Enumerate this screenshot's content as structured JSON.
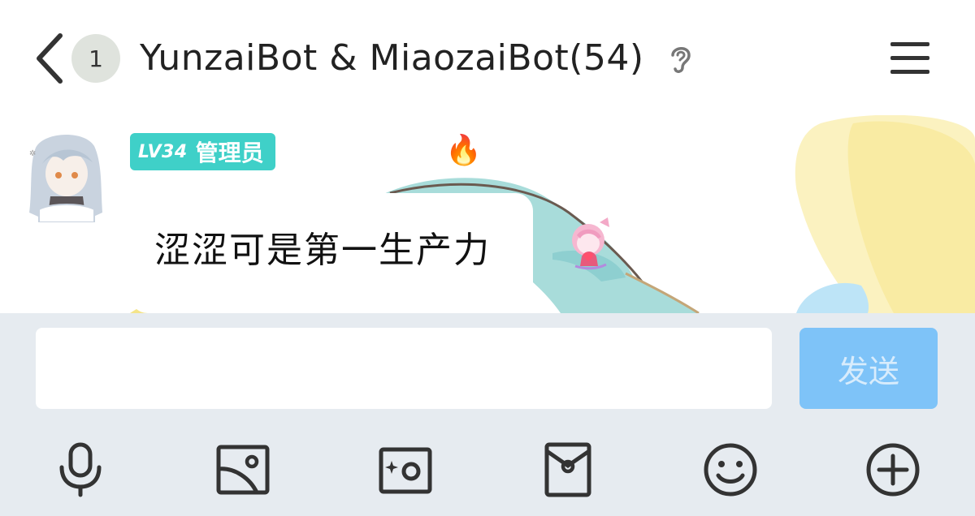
{
  "header": {
    "unread_count": "1",
    "title": "YunzaiBot & MiaozaiBot(54)"
  },
  "message": {
    "level": "LV34",
    "role": "管理员",
    "text": "涩涩可是第一生产力"
  },
  "composer": {
    "input_value": "",
    "send_label": "发送"
  },
  "toolbar": {
    "icons": [
      "microphone-icon",
      "image-icon",
      "camera-icon",
      "red-packet-icon",
      "emoji-icon",
      "plus-icon"
    ]
  },
  "colors": {
    "header_bg": "#ffffff",
    "input_bar_bg": "#e6ebf0",
    "send_button": "#7ec3f8",
    "level_tag": "#3fd0c8"
  }
}
